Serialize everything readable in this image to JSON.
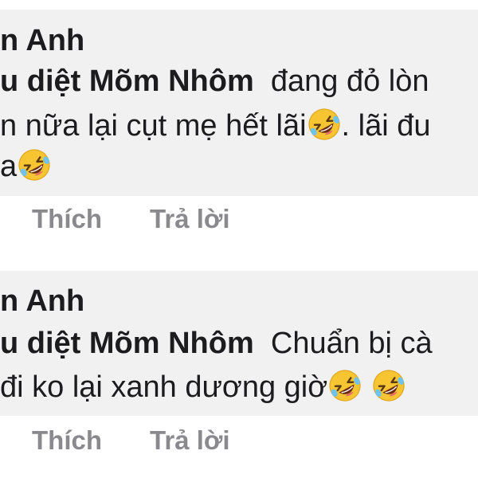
{
  "comments": [
    {
      "author": "n Anh",
      "mention": "u diệt Mõm Nhôm",
      "text_line1": "đang đỏ lòn",
      "text_line2": "n nữa lại cụt mẹ hết lãi",
      "text_line2_after": ". lãi đu",
      "text_line3": "a",
      "like_label": "Thích",
      "reply_label": "Trả lời",
      "emoji": "rolling-on-floor-laughing-emoji"
    },
    {
      "author": "n Anh",
      "mention": "u diệt Mõm Nhôm",
      "text_line1": "Chuẩn bị cà",
      "text_line2": " đi ko lại  xanh dương giờ",
      "like_label": "Thích",
      "reply_label": "Trả lời",
      "emoji": "rolling-on-floor-laughing-emoji"
    }
  ]
}
